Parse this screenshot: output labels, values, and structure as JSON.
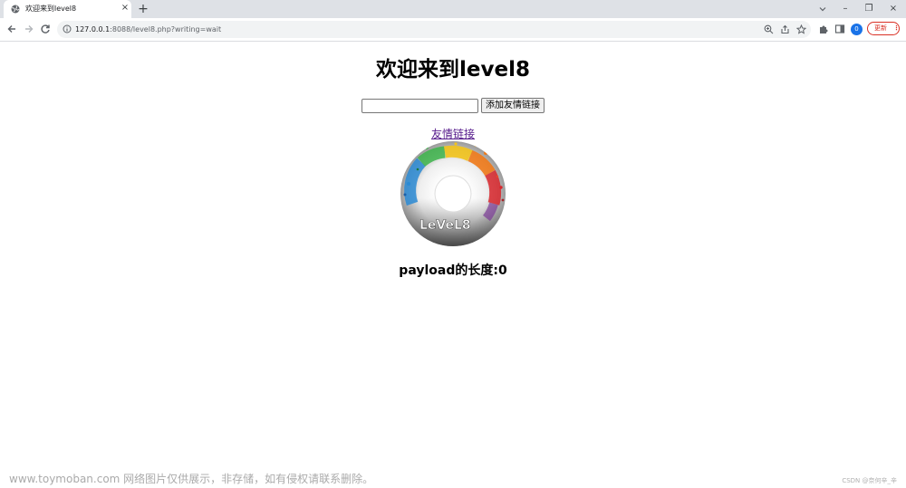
{
  "browser": {
    "tab": {
      "title": "欢迎来到level8",
      "close_glyph": "×",
      "favicon": "globe-icon"
    },
    "new_tab_glyph": "+",
    "window_controls": {
      "minimize": "–",
      "restore": "❐",
      "close": "×"
    },
    "nav": {
      "back": "back-arrow-icon",
      "forward": "forward-arrow-icon",
      "reload": "reload-icon"
    },
    "address": {
      "host": "127.0.0.1",
      "rest": ":8088/level8.php?writing=wait",
      "site_info_icon": "info-icon"
    },
    "toolbar_icons": [
      "zoom-icon",
      "share-icon",
      "star-icon",
      "extensions-icon",
      "side-panel-icon"
    ],
    "avatar_letter": "0",
    "update_button": {
      "label": "更新",
      "menu": "⋮"
    }
  },
  "page": {
    "title": "欢迎来到level8",
    "input_value": "",
    "add_button_label": "添加友情链接",
    "friend_link_text": "友情链接",
    "disc_caption": "LeVeL8",
    "payload_length_text": "payload的长度:0"
  },
  "watermarks": {
    "main": "www.toymoban.com 网络图片仅供展示，非存储，如有侵权请联系删除。",
    "csdn": "CSDN @奈何辛_辛"
  },
  "colors": {
    "tab_strip": "#dee1e6",
    "link_visited": "#551a8b",
    "update_red": "#d93025",
    "avatar_blue": "#1a73e8"
  }
}
